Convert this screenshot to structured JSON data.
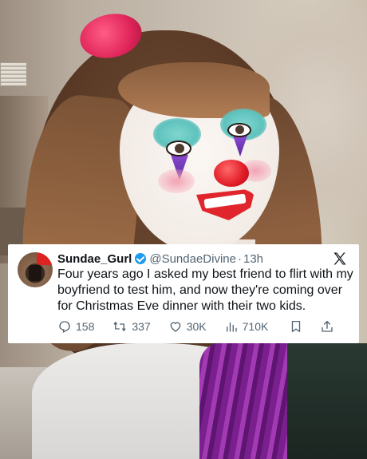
{
  "tweet": {
    "display_name": "Sundae_Gurl",
    "handle": "@SundaeDivine",
    "separator": "·",
    "time_ago": "13h",
    "text": "Four years ago I asked my best friend to flirt with my boyfriend to test him, and now they're coming over for Christmas Eve dinner with their two kids.",
    "stats": {
      "replies": "158",
      "reposts": "337",
      "likes": "30K",
      "views": "710K"
    },
    "icons": {
      "brand": "x-logo-icon",
      "verified": "verified-badge-icon",
      "reply": "reply-icon",
      "repost": "repost-icon",
      "like": "heart-icon",
      "views": "views-icon",
      "bookmark": "bookmark-icon",
      "share": "share-icon"
    },
    "colors": {
      "verified": "#1d9bf0",
      "text": "#0f1419",
      "muted": "#536471",
      "card_bg": "#ffffff"
    }
  }
}
